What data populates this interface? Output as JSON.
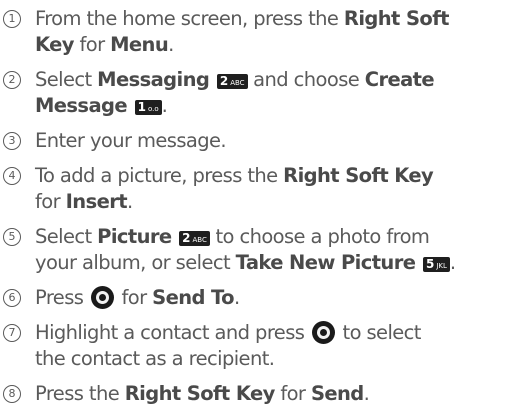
{
  "steps": [
    {
      "num": "1",
      "parts": [
        {
          "t": "From the home screen, press the "
        },
        {
          "t": "Right Soft",
          "b": true
        },
        {
          "br": true
        },
        {
          "t": "Key",
          "b": true
        },
        {
          "t": " for "
        },
        {
          "t": "Menu",
          "b": true
        },
        {
          "t": "."
        }
      ]
    },
    {
      "num": "2",
      "parts": [
        {
          "t": "Select "
        },
        {
          "t": "Messaging",
          "b": true
        },
        {
          "t": " "
        },
        {
          "key": "2",
          "letters": "ABC"
        },
        {
          "t": " and choose "
        },
        {
          "t": "Create",
          "b": true
        },
        {
          "br": true
        },
        {
          "t": "Message",
          "b": true
        },
        {
          "t": " "
        },
        {
          "key": "1",
          "letters": "o.o"
        },
        {
          "t": "."
        }
      ]
    },
    {
      "num": "3",
      "parts": [
        {
          "t": "Enter your message."
        }
      ]
    },
    {
      "num": "4",
      "parts": [
        {
          "t": "To add a picture, press the "
        },
        {
          "t": "Right Soft Key",
          "b": true
        },
        {
          "br": true
        },
        {
          "t": "for "
        },
        {
          "t": "Insert",
          "b": true
        },
        {
          "t": "."
        }
      ]
    },
    {
      "num": "5",
      "parts": [
        {
          "t": "Select "
        },
        {
          "t": "Picture",
          "b": true
        },
        {
          "t": " "
        },
        {
          "key": "2",
          "letters": "ABC"
        },
        {
          "t": " to choose a photo from"
        },
        {
          "br": true
        },
        {
          "t": "your album, or select "
        },
        {
          "t": "Take New Picture",
          "b": true
        },
        {
          "t": " "
        },
        {
          "key": "5",
          "letters": "JKL"
        },
        {
          "t": "."
        }
      ]
    },
    {
      "num": "6",
      "parts": [
        {
          "t": "Press "
        },
        {
          "nav": true
        },
        {
          "t": " for "
        },
        {
          "t": "Send To",
          "b": true
        },
        {
          "t": "."
        }
      ]
    },
    {
      "num": "7",
      "parts": [
        {
          "t": "Highlight a contact and press "
        },
        {
          "nav": true
        },
        {
          "t": " to select"
        },
        {
          "br": true
        },
        {
          "t": "the contact as a recipient."
        }
      ]
    },
    {
      "num": "8",
      "parts": [
        {
          "t": "Press the "
        },
        {
          "t": "Right Soft Key",
          "b": true
        },
        {
          "t": " for "
        },
        {
          "t": "Send",
          "b": true
        },
        {
          "t": "."
        }
      ]
    }
  ]
}
